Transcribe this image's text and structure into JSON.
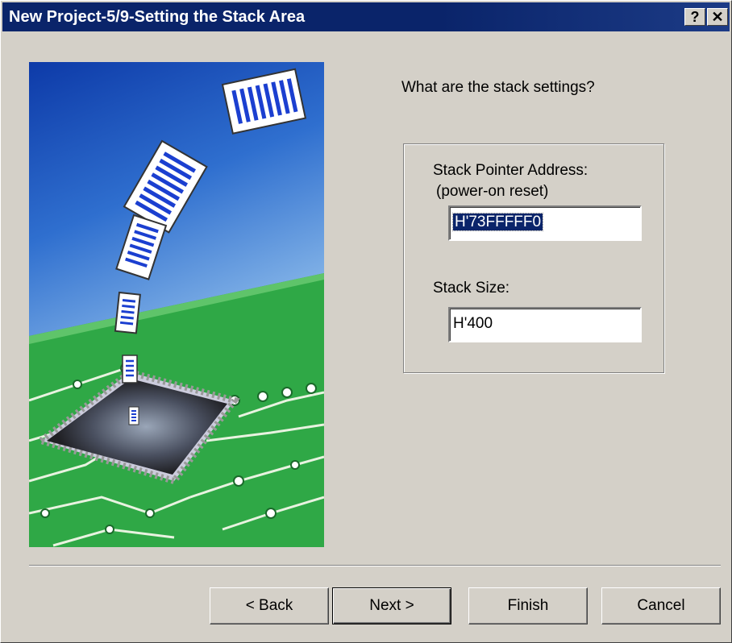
{
  "window": {
    "title": "New Project-5/9-Setting the Stack Area",
    "help_label": "?",
    "close_label": "✕"
  },
  "main": {
    "question": "What are the stack settings?",
    "stack_pointer": {
      "label": "Stack Pointer Address:",
      "sublabel": "(power-on reset)",
      "value": "H'73FFFFF0"
    },
    "stack_size": {
      "label": "Stack Size:",
      "value": "H'400"
    }
  },
  "buttons": {
    "back": "< Back",
    "next": "Next >",
    "finish": "Finish",
    "cancel": "Cancel"
  }
}
